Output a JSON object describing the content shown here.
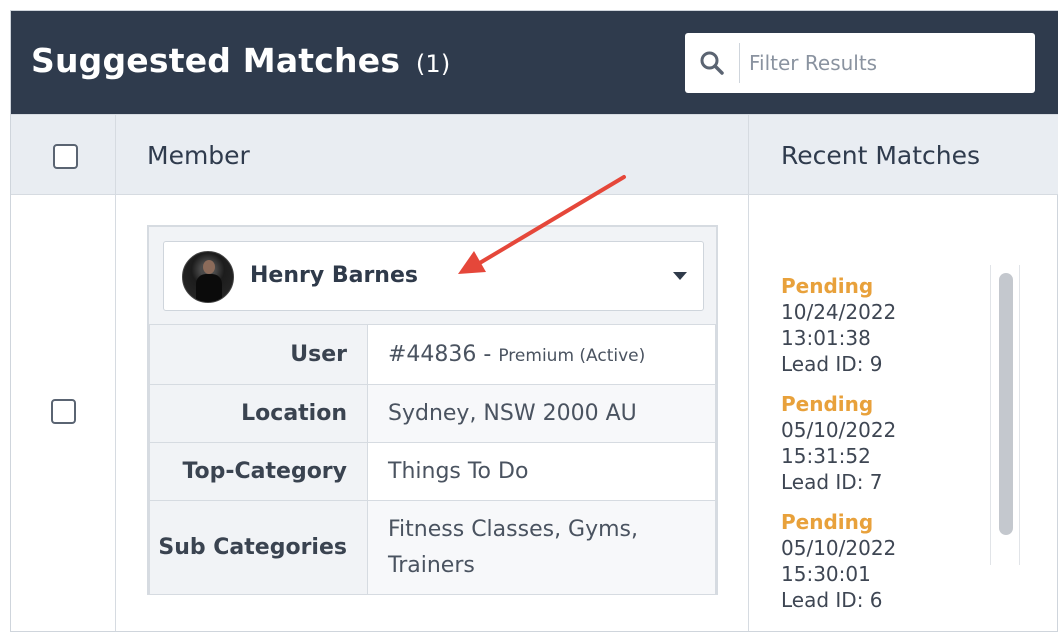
{
  "header": {
    "title": "Suggested Matches",
    "count": "(1)",
    "filter_placeholder": "Filter Results"
  },
  "table": {
    "columns": [
      "Member",
      "Recent Matches"
    ]
  },
  "member": {
    "name": "Henry Barnes",
    "details": [
      {
        "label": "User",
        "value": "#44836 -",
        "note": "Premium (Active)"
      },
      {
        "label": "Location",
        "value": "Sydney, NSW 2000 AU"
      },
      {
        "label": "Top-Category",
        "value": "Things To Do"
      },
      {
        "label": "Sub Categories",
        "value_line1": "Fitness Classes, Gyms,",
        "value_line2": "Trainers"
      }
    ]
  },
  "recent_matches": [
    {
      "status": "Pending",
      "datetime": "10/24/2022 13:01:38",
      "lead": "Lead ID: 9"
    },
    {
      "status": "Pending",
      "datetime": "05/10/2022 15:31:52",
      "lead": "Lead ID: 7"
    },
    {
      "status": "Pending",
      "datetime": "05/10/2022 15:30:01",
      "lead": "Lead ID: 6"
    }
  ],
  "colors": {
    "header_bg": "#2f3b4d",
    "pending": "#e8a13b",
    "annotation_arrow": "#e5473a"
  },
  "icons": {
    "search": "search-icon",
    "dropdown": "caret-down-icon",
    "arrow": "annotation-arrow-icon"
  }
}
